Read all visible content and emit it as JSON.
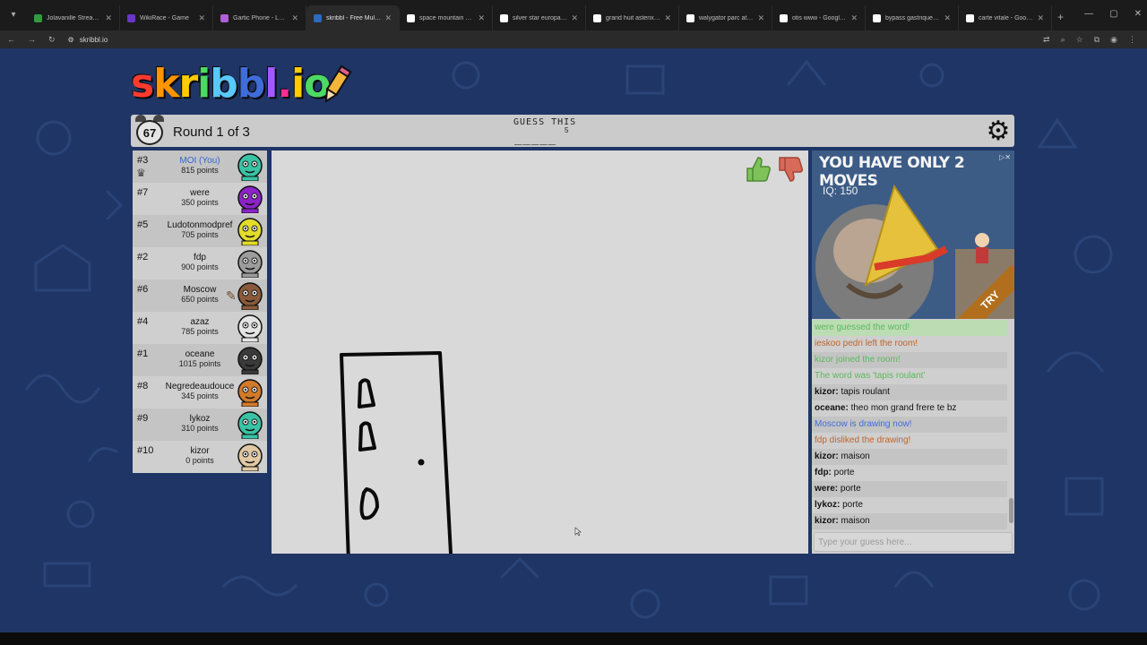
{
  "browser": {
    "tabs": [
      {
        "title": "Jolavanille Stream - Watc",
        "color": "#2e9d3f"
      },
      {
        "title": "WikiRace - Game",
        "color": "#6a35c9"
      },
      {
        "title": "Gartic Phone - Le jeu du t",
        "color": "#b05fd6"
      },
      {
        "title": "skribbl - Free Multiplayer",
        "color": "#2c6bbd",
        "active": true
      },
      {
        "title": "space mountain disneylo",
        "color": "#ffffff"
      },
      {
        "title": "silver star europapark - G",
        "color": "#ffffff"
      },
      {
        "title": "grand huit asterix - Goog",
        "color": "#ffffff"
      },
      {
        "title": "walygator parc attraction",
        "color": "#ffffff"
      },
      {
        "title": "otis www - Google'da Ara",
        "color": "#ffffff"
      },
      {
        "title": "bypass gastrique - Google",
        "color": "#ffffff"
      },
      {
        "title": "carte vitale - Google'da A",
        "color": "#ffffff"
      }
    ],
    "url": "skribbl.io"
  },
  "logo": {
    "text": "skribbl.io"
  },
  "game": {
    "timer": "67",
    "round": "Round 1 of 3",
    "guess_label": "GUESS THIS",
    "word_blanks": "_____",
    "word_length": "5"
  },
  "players": [
    {
      "rank": "#3",
      "name": "MOI (You)",
      "points": "815 points",
      "you": true,
      "avatar": "#39c3a4"
    },
    {
      "rank": "#7",
      "name": "were",
      "points": "350 points",
      "avatar": "#8b23c9"
    },
    {
      "rank": "#5",
      "name": "Ludotonmodpref",
      "points": "705 points",
      "avatar": "#e3dc2a"
    },
    {
      "rank": "#2",
      "name": "fdp",
      "points": "900 points",
      "avatar": "#9c9c9c"
    },
    {
      "rank": "#6",
      "name": "Moscow",
      "points": "650 points",
      "avatar": "#8b5a3c"
    },
    {
      "rank": "#4",
      "name": "azaz",
      "points": "785 points",
      "avatar": "#e4e4e4"
    },
    {
      "rank": "#1",
      "name": "oceane",
      "points": "1015 points",
      "avatar": "#3a3a3a"
    },
    {
      "rank": "#8",
      "name": "Negredeaudouce",
      "points": "345 points",
      "avatar": "#d27a2a"
    },
    {
      "rank": "#9",
      "name": "lykoz",
      "points": "310 points",
      "avatar": "#39c3a4"
    },
    {
      "rank": "#10",
      "name": "kizor",
      "points": "0 points",
      "avatar": "#e0c9a4"
    }
  ],
  "bubbles": {
    "were": "porte",
    "lykoz": "porte",
    "kizor": "maison"
  },
  "ad": {
    "headline": "YOU HAVE ONLY 2 MOVES",
    "iq": "IQ: 150",
    "try": "TRY"
  },
  "chat": [
    {
      "text": "were guessed the word!",
      "style": "green hl"
    },
    {
      "text": "ieskoo pedri left the room!",
      "style": "orange"
    },
    {
      "text": "kizor joined the room!",
      "style": "green alt"
    },
    {
      "text": "The word was 'tapis roulant'",
      "style": "green"
    },
    {
      "user": "kizor:",
      "text": " tapis roulant",
      "style": "alt"
    },
    {
      "user": "oceane:",
      "text": " theo mon grand frere te bz",
      "style": ""
    },
    {
      "text": "Moscow is drawing now!",
      "style": "blue alt"
    },
    {
      "text": "fdp disliked the drawing!",
      "style": "orange"
    },
    {
      "user": "kizor:",
      "text": " maison",
      "style": "alt"
    },
    {
      "user": "fdp:",
      "text": " porte",
      "style": ""
    },
    {
      "user": "were:",
      "text": " porte",
      "style": "alt"
    },
    {
      "user": "lykoz:",
      "text": " porte",
      "style": ""
    },
    {
      "user": "kizor:",
      "text": " maison",
      "style": "alt"
    }
  ],
  "chat_input": {
    "placeholder": "Type your guess here..."
  }
}
